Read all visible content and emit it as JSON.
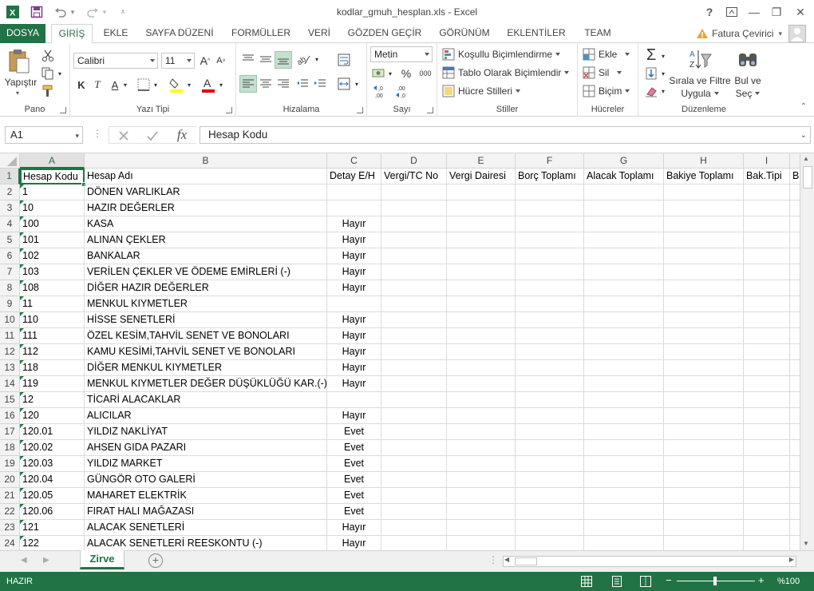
{
  "window": {
    "title": "kodlar_gmuh_hesplan.xls - Excel",
    "help_glyph": "?",
    "restore_glyph": "▭",
    "minimize_glyph": "—",
    "maximize_glyph": "❐",
    "close_glyph": "✕"
  },
  "tabs": [
    "DOSYA",
    "GİRİŞ",
    "EKLE",
    "SAYFA DÜZENİ",
    "FORMÜLLER",
    "VERİ",
    "GÖZDEN GEÇİR",
    "GÖRÜNÜM",
    "EKLENTİLER",
    "TEAM"
  ],
  "user": {
    "name": "Fatura Çevirici"
  },
  "ribbon": {
    "pano": {
      "label": "Pano",
      "paste": "Yapıştır"
    },
    "font": {
      "label": "Yazı Tipi",
      "family": "Calibri",
      "size": "11",
      "bold": "K",
      "italic": "T",
      "underline": "A"
    },
    "align": {
      "label": "Hizalama"
    },
    "number": {
      "label": "Sayı",
      "format": "Metin",
      "percent": "%",
      "thousands": "000",
      "inc_decimal": ",0\n,00",
      "dec_decimal": ",00\n,0"
    },
    "styles": {
      "label": "Stiller",
      "conditional": "Koşullu Biçimlendirme",
      "table": "Tablo Olarak Biçimlendir",
      "cell": "Hücre Stilleri"
    },
    "cells": {
      "label": "Hücreler",
      "insert": "Ekle",
      "delete": "Sil",
      "format": "Biçim"
    },
    "editing": {
      "label": "Düzenleme",
      "sort1": "Sırala ve Filtre",
      "sort2": "Uygula",
      "find1": "Bul ve",
      "find2": "Seç"
    }
  },
  "formula_bar": {
    "name_box": "A1",
    "content": "Hesap Kodu",
    "fx": "fx"
  },
  "columns": [
    "A",
    "B",
    "C",
    "D",
    "E",
    "F",
    "G",
    "H",
    "I"
  ],
  "header_row": [
    "Hesap Kodu",
    "Hesap Adı",
    "Detay E/H",
    "Vergi/TC No",
    "Vergi Dairesi",
    "Borç Toplamı",
    "Alacak Toplamı",
    "Bakiye Toplamı",
    "Bak.Tipi",
    "B"
  ],
  "rows": [
    {
      "n": "2",
      "a": "1",
      "b": "DÖNEN VARLIKLAR",
      "c": ""
    },
    {
      "n": "3",
      "a": "10",
      "b": "HAZIR DEĞERLER",
      "c": ""
    },
    {
      "n": "4",
      "a": "100",
      "b": "KASA",
      "c": "Hayır"
    },
    {
      "n": "5",
      "a": "101",
      "b": "ALINAN ÇEKLER",
      "c": "Hayır"
    },
    {
      "n": "6",
      "a": "102",
      "b": "BANKALAR",
      "c": "Hayır"
    },
    {
      "n": "7",
      "a": "103",
      "b": "VERİLEN ÇEKLER VE ÖDEME EMİRLERİ (-)",
      "c": "Hayır"
    },
    {
      "n": "8",
      "a": "108",
      "b": "DİĞER HAZIR DEĞERLER",
      "c": "Hayır"
    },
    {
      "n": "9",
      "a": "11",
      "b": "MENKUL KIYMETLER",
      "c": ""
    },
    {
      "n": "10",
      "a": "110",
      "b": "HİSSE SENETLERİ",
      "c": "Hayır"
    },
    {
      "n": "11",
      "a": "111",
      "b": "ÖZEL KESİM,TAHVİL SENET VE BONOLARI",
      "c": "Hayır"
    },
    {
      "n": "12",
      "a": "112",
      "b": "KAMU KESİMİ,TAHVİL SENET VE BONOLARI",
      "c": "Hayır"
    },
    {
      "n": "13",
      "a": "118",
      "b": "DİĞER MENKUL KIYMETLER",
      "c": "Hayır"
    },
    {
      "n": "14",
      "a": "119",
      "b": "MENKUL KIYMETLER DEĞER DÜŞÜKLÜĞÜ KAR.(-)",
      "c": "Hayır"
    },
    {
      "n": "15",
      "a": "12",
      "b": "TİCARİ ALACAKLAR",
      "c": ""
    },
    {
      "n": "16",
      "a": "120",
      "b": "ALICILAR",
      "c": "Hayır"
    },
    {
      "n": "17",
      "a": "120.01",
      "b": "YILDIZ NAKLİYAT",
      "c": "Evet"
    },
    {
      "n": "18",
      "a": "120.02",
      "b": "AHSEN GIDA PAZARI",
      "c": "Evet"
    },
    {
      "n": "19",
      "a": "120.03",
      "b": "YILDIZ MARKET",
      "c": "Evet"
    },
    {
      "n": "20",
      "a": "120.04",
      "b": "GÜNGÖR OTO GALERİ",
      "c": "Evet"
    },
    {
      "n": "21",
      "a": "120.05",
      "b": "MAHARET ELEKTRİK",
      "c": "Evet"
    },
    {
      "n": "22",
      "a": "120.06",
      "b": "FIRAT HALI MAĞAZASI",
      "c": "Evet"
    },
    {
      "n": "23",
      "a": "121",
      "b": "ALACAK SENETLERİ",
      "c": "Hayır"
    },
    {
      "n": "24",
      "a": "122",
      "b": "ALACAK SENETLERİ REESKONTU (-)",
      "c": "Hayır"
    }
  ],
  "sheets": [
    {
      "name": "Zirve",
      "active": true
    }
  ],
  "status": {
    "ready": "HAZIR",
    "zoom": "%100",
    "minus": "−",
    "plus": "+"
  },
  "colors": {
    "accent": "#217346",
    "text_indicator": "#1f7a3f"
  }
}
